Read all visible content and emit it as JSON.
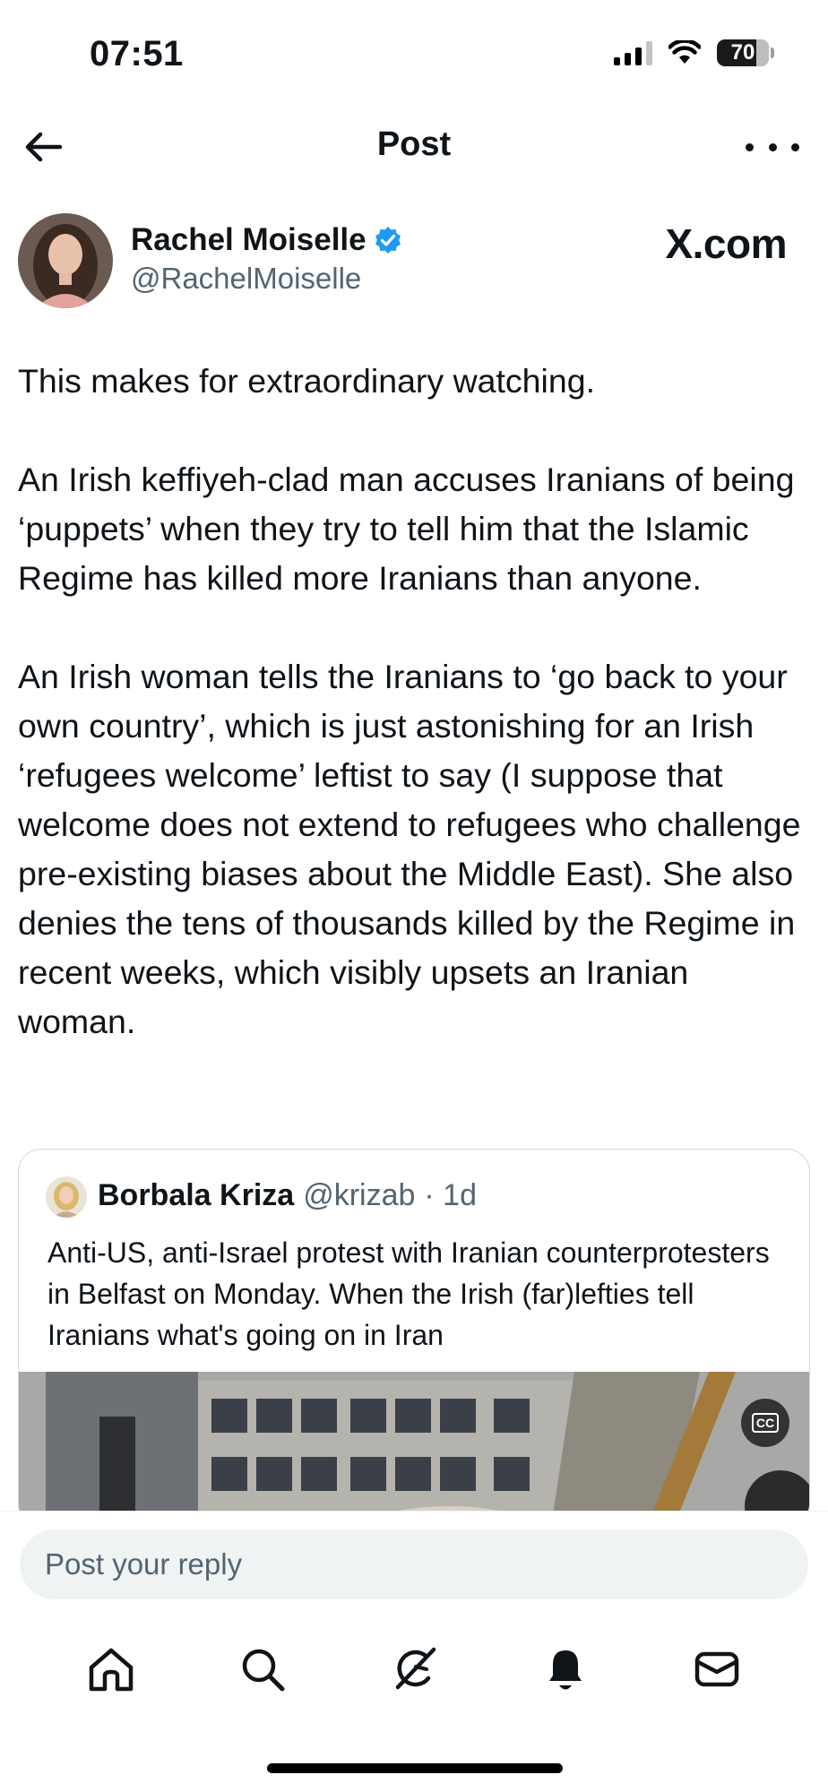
{
  "status_bar": {
    "time": "07:51",
    "battery": "70"
  },
  "header": {
    "title": "Post"
  },
  "author": {
    "name": "Rachel Moiselle",
    "handle": "@RachelMoiselle",
    "verified": true,
    "verified_color": "#1d9bf0"
  },
  "watermark": "X.com",
  "post": {
    "paragraphs": [
      "This makes for extraordinary watching.",
      "An Irish keffiyeh-clad man accuses Iranians of being ‘puppets’ when they try to tell him that the Islamic Regime has killed more Iranians than anyone.",
      "An Irish woman tells the Iranians to ‘go back to your own country’, which is just astonishing for an Irish ‘refugees welcome’ leftist to say (I suppose that welcome does not extend to refugees who challenge pre-existing biases about the Middle East). She also denies the tens of thousands killed by the Regime in recent weeks, which visibly upsets an Iranian woman."
    ]
  },
  "quote": {
    "name": "Borbala Kriza",
    "handle": "@krizab",
    "time": "· 1d",
    "text": "Anti-US, anti-Israel protest with Iranian counterprotesters in Belfast on Monday. When the Irish (far)lefties tell Iranians what's going on in Iran",
    "cc_label": "CC"
  },
  "reply": {
    "placeholder": "Post your reply"
  },
  "nav": {
    "items": [
      "home-icon",
      "search-icon",
      "grok-icon",
      "notifications-icon",
      "messages-icon"
    ]
  },
  "colors": {
    "text": "#0f1419",
    "secondary": "#536471",
    "border": "#cfd9de",
    "input_bg": "#eff3f4",
    "verified": "#1d9bf0"
  }
}
